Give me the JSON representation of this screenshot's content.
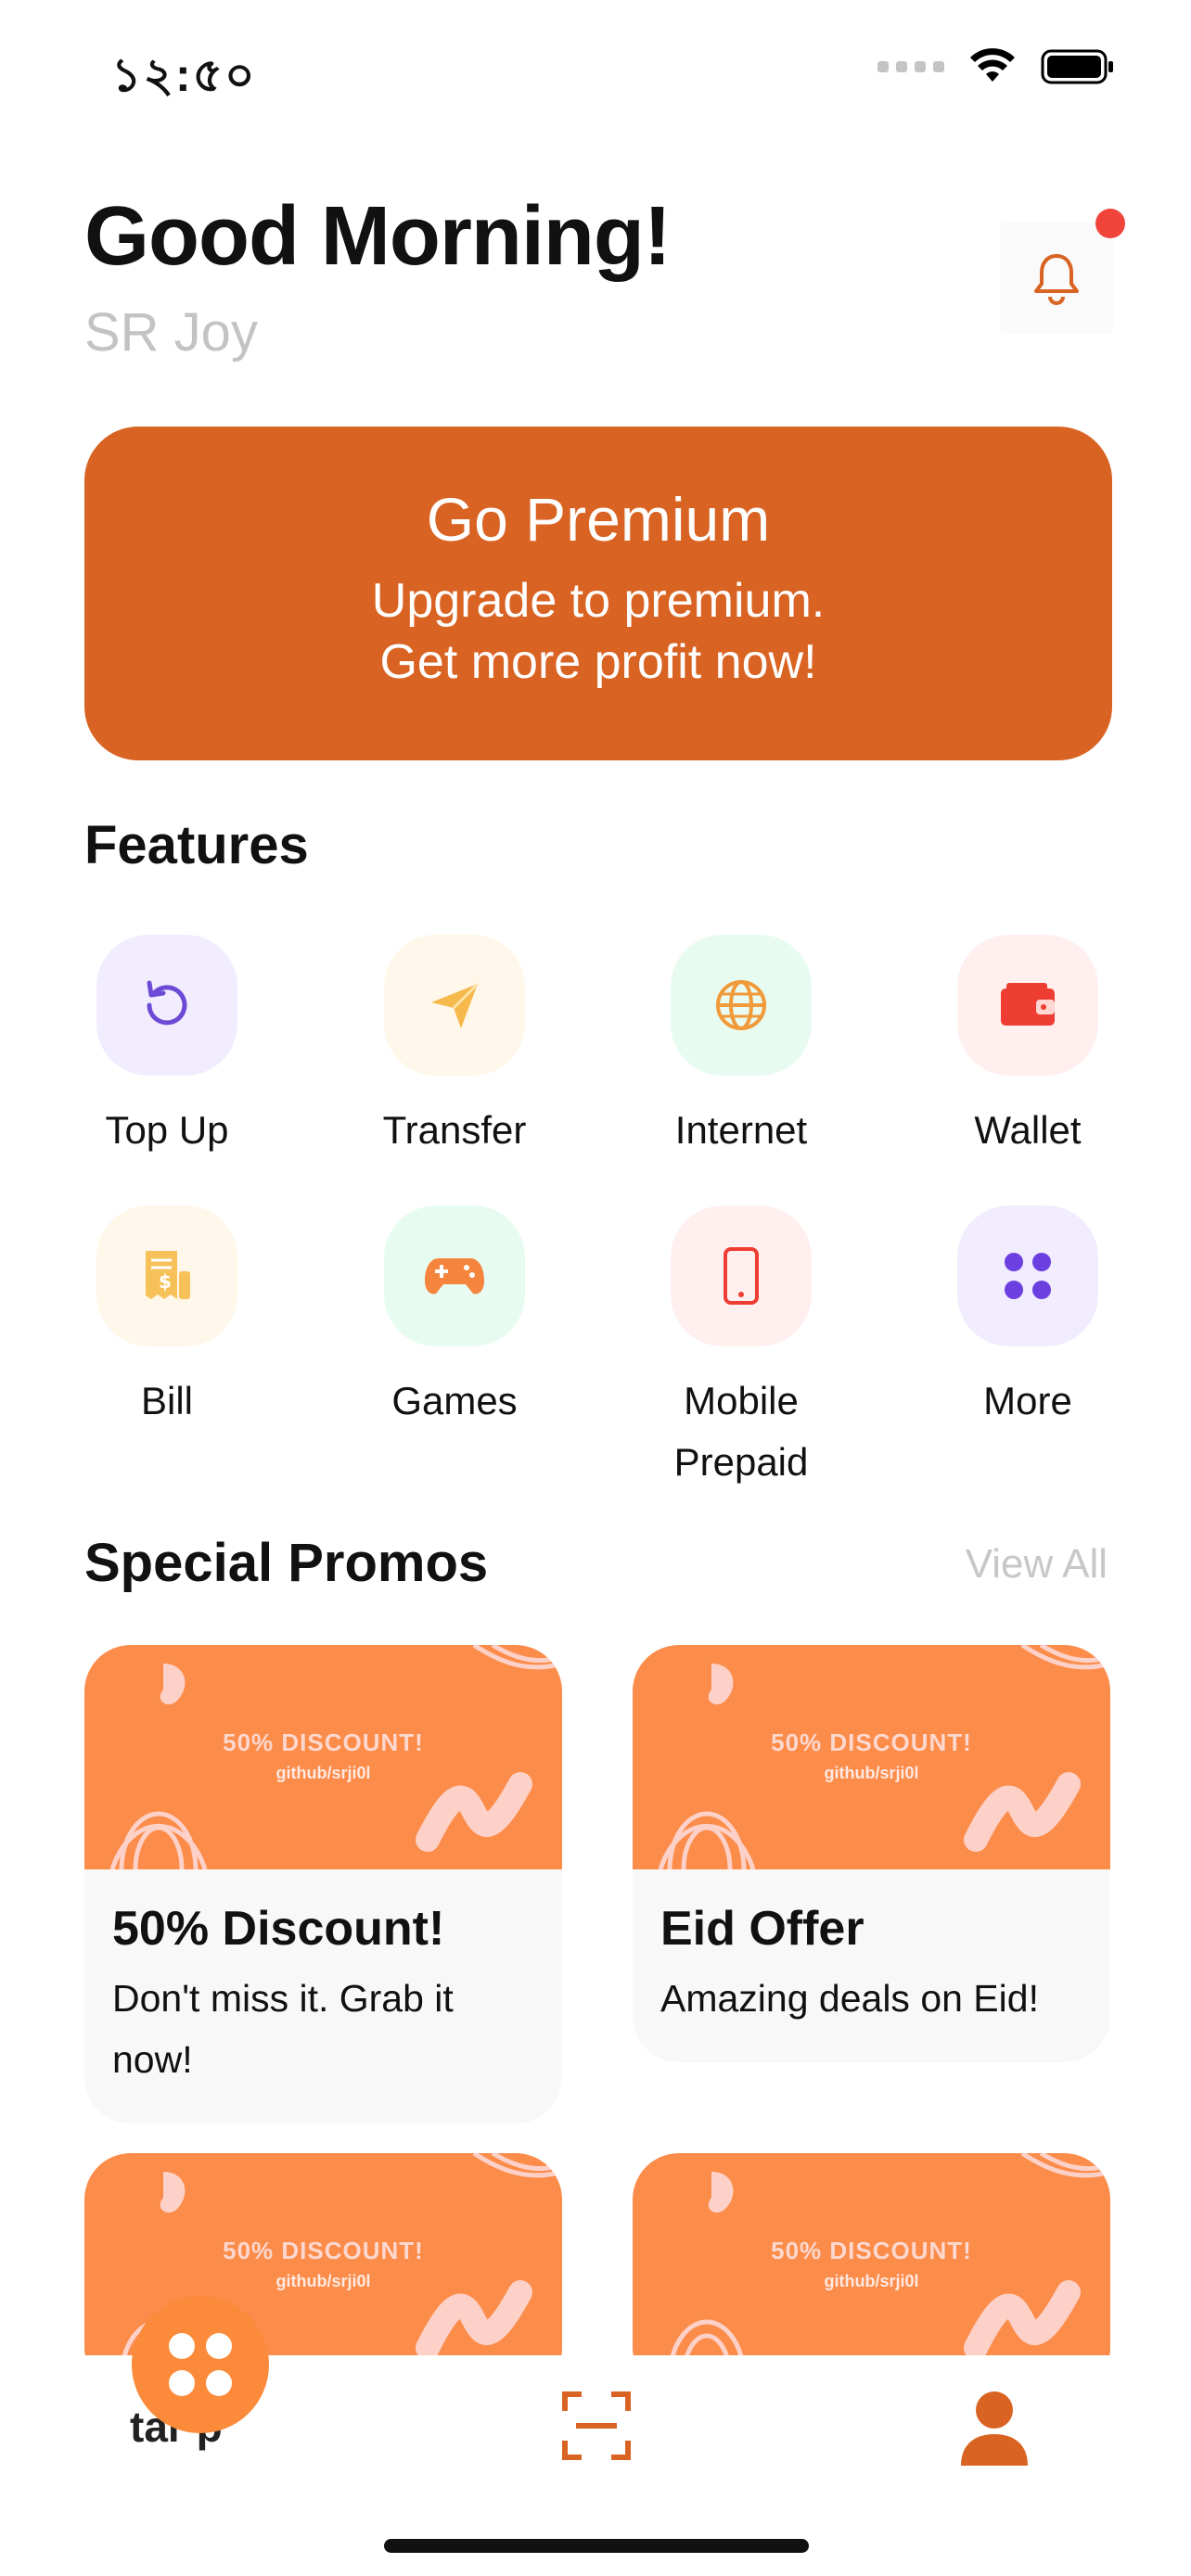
{
  "status_bar": {
    "time": "১২:৫০"
  },
  "header": {
    "greeting": "Good Morning!",
    "username": "SR Joy"
  },
  "premium": {
    "title": "Go Premium",
    "line1": "Upgrade to premium.",
    "line2": "Get more profit now!"
  },
  "features": {
    "title": "Features",
    "items": [
      {
        "label": "Top Up",
        "icon": "refresh-icon"
      },
      {
        "label": "Transfer",
        "icon": "send-icon"
      },
      {
        "label": "Internet",
        "icon": "globe-icon"
      },
      {
        "label": "Wallet",
        "icon": "wallet-icon"
      },
      {
        "label": "Bill",
        "icon": "bill-icon"
      },
      {
        "label": "Games",
        "icon": "gamepad-icon"
      },
      {
        "label": "Mobile\nPrepaid",
        "icon": "phone-icon"
      },
      {
        "label": "More",
        "icon": "grid-dots-icon"
      }
    ]
  },
  "promos": {
    "title": "Special Promos",
    "view_all": "View All",
    "banner_title": "50% DISCOUNT!",
    "banner_sub": "github/srji0l",
    "items": [
      {
        "title": "50% Discount!",
        "description": "Don't miss it. Grab it now!"
      },
      {
        "title": "Eid Offer",
        "description": "Amazing deals on Eid!"
      }
    ]
  },
  "bottom_nav": {
    "fab_peek": "tar p"
  },
  "colors": {
    "accent": "#d96322",
    "promo_orange": "#fc8c4a",
    "fab_orange": "#fb8b3a",
    "notification": "#f0443b"
  }
}
